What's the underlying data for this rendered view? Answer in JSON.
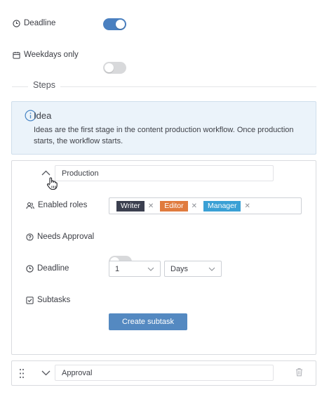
{
  "settings": {
    "deadline_label": "Deadline",
    "deadline_enabled": true,
    "weekdays_label": "Weekdays only",
    "weekdays_enabled": false
  },
  "steps": {
    "title": "Steps",
    "info": {
      "title": "Idea",
      "text": "Ideas are the first stage in the content production workflow. Once production starts, the workflow starts."
    },
    "production": {
      "name": "Production",
      "enabled_roles_label": "Enabled roles",
      "roles": [
        {
          "label": "Writer",
          "color": "#3b3f4f"
        },
        {
          "label": "Editor",
          "color": "#e07b3e"
        },
        {
          "label": "Manager",
          "color": "#3aa0d5"
        }
      ],
      "needs_approval_label": "Needs Approval",
      "needs_approval_enabled": false,
      "deadline_label": "Deadline",
      "deadline_value": "1",
      "deadline_unit": "Days",
      "subtasks_label": "Subtasks",
      "create_subtask_label": "Create subtask"
    },
    "approval": {
      "name": "Approval"
    }
  },
  "colors": {
    "accent": "#4a80c0",
    "button": "#5489c1",
    "info_bg": "#ebf3fa",
    "info_icon": "#4a86c5"
  }
}
